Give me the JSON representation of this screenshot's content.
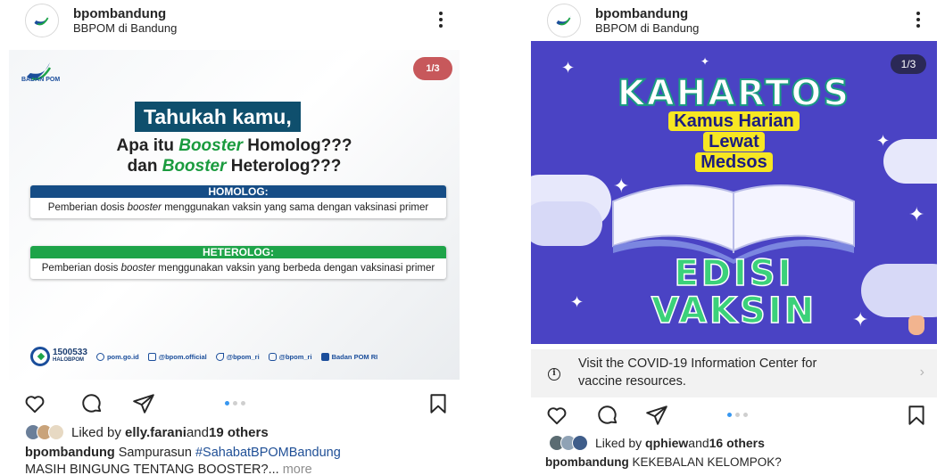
{
  "posts": [
    {
      "header": {
        "username": "bpombandung",
        "location": "BBPOM di Bandung"
      },
      "image": {
        "org_label": "BADAN POM",
        "counter": "1/3",
        "headline": "Tahukah kamu,",
        "question_pre": "Apa itu ",
        "question_b1": "Booster",
        "question_mid": " Homolog???",
        "question_line2_pre": "dan ",
        "question_b2": "Booster",
        "question_line2_post": " Heterolog???",
        "homolog_title": "HOMOLOG:",
        "homolog_text_pre": "Pemberian dosis ",
        "homolog_text_em": "booster",
        "homolog_text_post": " menggunakan vaksin yang sama dengan vaksinasi primer",
        "heterolog_title": "HETEROLOG:",
        "heterolog_text_pre": "Pemberian dosis ",
        "heterolog_text_em": "booster",
        "heterolog_text_post": " menggunakan vaksin yang berbeda dengan vaksinasi primer",
        "hotline": "1500533",
        "hotline_sub": "HALOBPOM",
        "footer_links": [
          "pom.go.id",
          "@bpom.official",
          "@bpom_ri",
          "@bpom_ri",
          "Badan POM RI"
        ]
      },
      "likes": {
        "prefix": "Liked by ",
        "user": "elly.farani",
        "mid": " and ",
        "others": "19 others"
      },
      "caption": {
        "username": "bpombandung",
        "text": " Sampurasun ",
        "hashtag": "#SahabatBPOMBandung",
        "line2": "MASIH BINGUNG TENTANG BOOSTER?...",
        "more": " more"
      }
    },
    {
      "header": {
        "username": "bpombandung",
        "location": "BBPOM di Bandung"
      },
      "image": {
        "counter": "1/3",
        "title": "KAHARTOS",
        "line1": "Kamus Harian",
        "line2": "Lewat",
        "line3": "Medsos",
        "edisi": "EDISI",
        "vaksin": "VAKSIN"
      },
      "covid_banner": {
        "text": "Visit the COVID-19 Information Center for vaccine resources."
      },
      "likes": {
        "prefix": "Liked by ",
        "user": "qphiew",
        "mid": " and ",
        "others": "16 others"
      },
      "caption": {
        "username": "bpombandung",
        "text": " KEKEBALAN KELOMPOK?"
      }
    }
  ],
  "colors": {
    "accent_blue": "#3897f0",
    "bpom_navy": "#164d86",
    "bpom_green": "#1ea449",
    "kahartos_bg": "#4a43c4",
    "kahartos_yellow": "#f7e722"
  },
  "icons": [
    "more-icon",
    "heart-icon",
    "comment-icon",
    "share-icon",
    "bookmark-icon",
    "info-icon",
    "chevron-right-icon"
  ]
}
